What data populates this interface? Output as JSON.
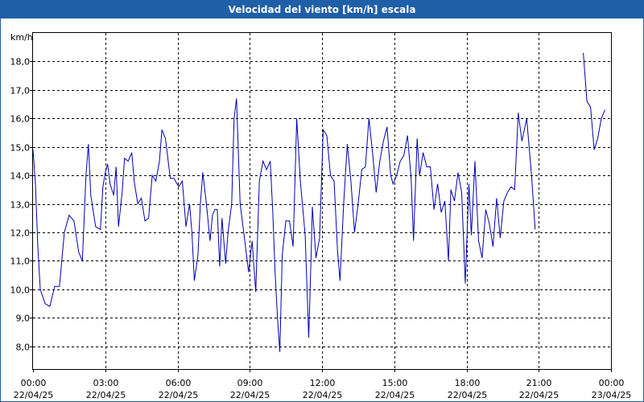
{
  "chart_data": {
    "type": "line",
    "title": "Velocidad del viento [km/h] escala",
    "ylabel": "km/h",
    "ylim": [
      7.2,
      19.0
    ],
    "yticks": [
      "8,0",
      "9,0",
      "10,0",
      "11,0",
      "12,0",
      "13,0",
      "14,0",
      "15,0",
      "16,0",
      "17,0",
      "18,0"
    ],
    "xlim_hours": [
      0,
      24
    ],
    "xticks": [
      {
        "time": "00:00",
        "date": "22/04/25"
      },
      {
        "time": "03:00",
        "date": "22/04/25"
      },
      {
        "time": "06:00",
        "date": "22/04/25"
      },
      {
        "time": "09:00",
        "date": "22/04/25"
      },
      {
        "time": "12:00",
        "date": "22/04/25"
      },
      {
        "time": "15:00",
        "date": "22/04/25"
      },
      {
        "time": "18:00",
        "date": "22/04/25"
      },
      {
        "time": "21:00",
        "date": "22/04/25"
      },
      {
        "time": "00:00",
        "date": "23/04/25"
      }
    ],
    "grid": true,
    "color": "#0000b4",
    "series": [
      {
        "segments": [
          [
            [
              0.0,
              14.9
            ],
            [
              0.1,
              13.7
            ],
            [
              0.2,
              11.5
            ],
            [
              0.3,
              10.0
            ],
            [
              0.5,
              9.5
            ],
            [
              0.7,
              9.4
            ],
            [
              0.9,
              10.1
            ],
            [
              1.1,
              10.1
            ],
            [
              1.3,
              12.0
            ],
            [
              1.5,
              12.6
            ],
            [
              1.7,
              12.4
            ],
            [
              1.9,
              11.3
            ],
            [
              2.05,
              11.0
            ],
            [
              2.2,
              14.0
            ],
            [
              2.3,
              15.1
            ],
            [
              2.4,
              13.3
            ],
            [
              2.6,
              12.2
            ],
            [
              2.8,
              12.1
            ],
            [
              2.9,
              13.6
            ],
            [
              3.0,
              14.1
            ],
            [
              3.1,
              14.4
            ],
            [
              3.2,
              13.7
            ],
            [
              3.35,
              13.3
            ],
            [
              3.45,
              14.3
            ],
            [
              3.55,
              12.2
            ],
            [
              3.7,
              13.4
            ],
            [
              3.8,
              14.6
            ],
            [
              3.95,
              14.5
            ],
            [
              4.1,
              14.8
            ],
            [
              4.2,
              13.8
            ],
            [
              4.35,
              13.0
            ],
            [
              4.5,
              13.2
            ],
            [
              4.65,
              12.4
            ],
            [
              4.8,
              12.5
            ],
            [
              4.95,
              14.0
            ],
            [
              5.1,
              13.8
            ],
            [
              5.25,
              14.5
            ],
            [
              5.35,
              15.6
            ],
            [
              5.5,
              15.3
            ],
            [
              5.7,
              13.9
            ],
            [
              5.85,
              13.9
            ],
            [
              6.05,
              13.6
            ],
            [
              6.2,
              13.8
            ],
            [
              6.35,
              12.2
            ],
            [
              6.5,
              13.0
            ],
            [
              6.6,
              12.0
            ],
            [
              6.7,
              10.3
            ],
            [
              6.85,
              11.2
            ],
            [
              6.95,
              13.0
            ],
            [
              7.05,
              14.1
            ],
            [
              7.2,
              13.0
            ],
            [
              7.35,
              11.7
            ],
            [
              7.45,
              12.6
            ],
            [
              7.55,
              12.8
            ],
            [
              7.65,
              12.8
            ],
            [
              7.75,
              10.8
            ],
            [
              7.85,
              12.5
            ],
            [
              8.0,
              10.9
            ],
            [
              8.1,
              12.0
            ],
            [
              8.25,
              13.0
            ],
            [
              8.35,
              16.0
            ],
            [
              8.45,
              16.7
            ],
            [
              8.6,
              13.0
            ],
            [
              8.75,
              12.0
            ],
            [
              8.95,
              10.6
            ],
            [
              9.1,
              11.7
            ],
            [
              9.25,
              9.9
            ],
            [
              9.4,
              13.8
            ],
            [
              9.55,
              14.5
            ],
            [
              9.7,
              14.2
            ],
            [
              9.85,
              14.5
            ],
            [
              9.95,
              12.8
            ],
            [
              10.05,
              10.6
            ],
            [
              10.15,
              9.0
            ],
            [
              10.25,
              7.8
            ],
            [
              10.35,
              11.2
            ],
            [
              10.5,
              12.4
            ],
            [
              10.65,
              12.4
            ],
            [
              10.8,
              11.5
            ],
            [
              10.95,
              16.0
            ],
            [
              11.1,
              13.8
            ],
            [
              11.3,
              11.9
            ],
            [
              11.45,
              8.3
            ],
            [
              11.55,
              11.2
            ],
            [
              11.6,
              12.9
            ],
            [
              11.75,
              11.1
            ],
            [
              11.9,
              11.8
            ],
            [
              12.05,
              15.6
            ],
            [
              12.2,
              15.4
            ],
            [
              12.35,
              14.0
            ],
            [
              12.5,
              13.8
            ],
            [
              12.65,
              11.3
            ],
            [
              12.75,
              10.3
            ],
            [
              12.9,
              13.0
            ],
            [
              13.05,
              15.1
            ],
            [
              13.2,
              13.8
            ],
            [
              13.35,
              12.0
            ],
            [
              13.5,
              13.0
            ],
            [
              13.65,
              14.2
            ],
            [
              13.8,
              14.3
            ],
            [
              13.95,
              16.0
            ],
            [
              14.1,
              14.8
            ],
            [
              14.25,
              13.4
            ],
            [
              14.4,
              14.5
            ],
            [
              14.55,
              15.2
            ],
            [
              14.7,
              15.7
            ],
            [
              14.85,
              14.0
            ],
            [
              14.95,
              13.7
            ],
            [
              15.1,
              14.0
            ],
            [
              15.25,
              14.5
            ],
            [
              15.4,
              14.7
            ],
            [
              15.55,
              15.4
            ],
            [
              15.7,
              13.9
            ],
            [
              15.8,
              11.7
            ],
            [
              15.95,
              15.3
            ],
            [
              16.05,
              14.0
            ],
            [
              16.2,
              14.8
            ],
            [
              16.35,
              14.3
            ],
            [
              16.5,
              14.3
            ],
            [
              16.65,
              12.8
            ],
            [
              16.8,
              13.7
            ],
            [
              16.95,
              12.7
            ],
            [
              17.1,
              13.1
            ],
            [
              17.25,
              11.0
            ],
            [
              17.35,
              13.5
            ],
            [
              17.5,
              13.1
            ],
            [
              17.65,
              14.1
            ],
            [
              17.8,
              13.4
            ],
            [
              17.95,
              10.2
            ],
            [
              18.1,
              13.7
            ],
            [
              18.2,
              11.9
            ],
            [
              18.35,
              14.5
            ],
            [
              18.5,
              11.7
            ],
            [
              18.65,
              11.1
            ],
            [
              18.8,
              12.8
            ],
            [
              18.95,
              12.3
            ],
            [
              19.1,
              11.5
            ],
            [
              19.25,
              13.2
            ],
            [
              19.4,
              11.8
            ],
            [
              19.55,
              13.1
            ],
            [
              19.7,
              13.4
            ],
            [
              19.85,
              13.6
            ],
            [
              20.0,
              13.5
            ],
            [
              20.15,
              16.2
            ],
            [
              20.3,
              15.2
            ],
            [
              20.5,
              16.0
            ],
            [
              20.7,
              14.0
            ],
            [
              20.85,
              12.1
            ]
          ],
          [
            [
              22.85,
              18.3
            ],
            [
              23.0,
              16.6
            ],
            [
              23.15,
              16.4
            ],
            [
              23.3,
              14.9
            ],
            [
              23.45,
              15.3
            ],
            [
              23.6,
              16.0
            ],
            [
              23.75,
              16.3
            ]
          ]
        ]
      }
    ]
  }
}
